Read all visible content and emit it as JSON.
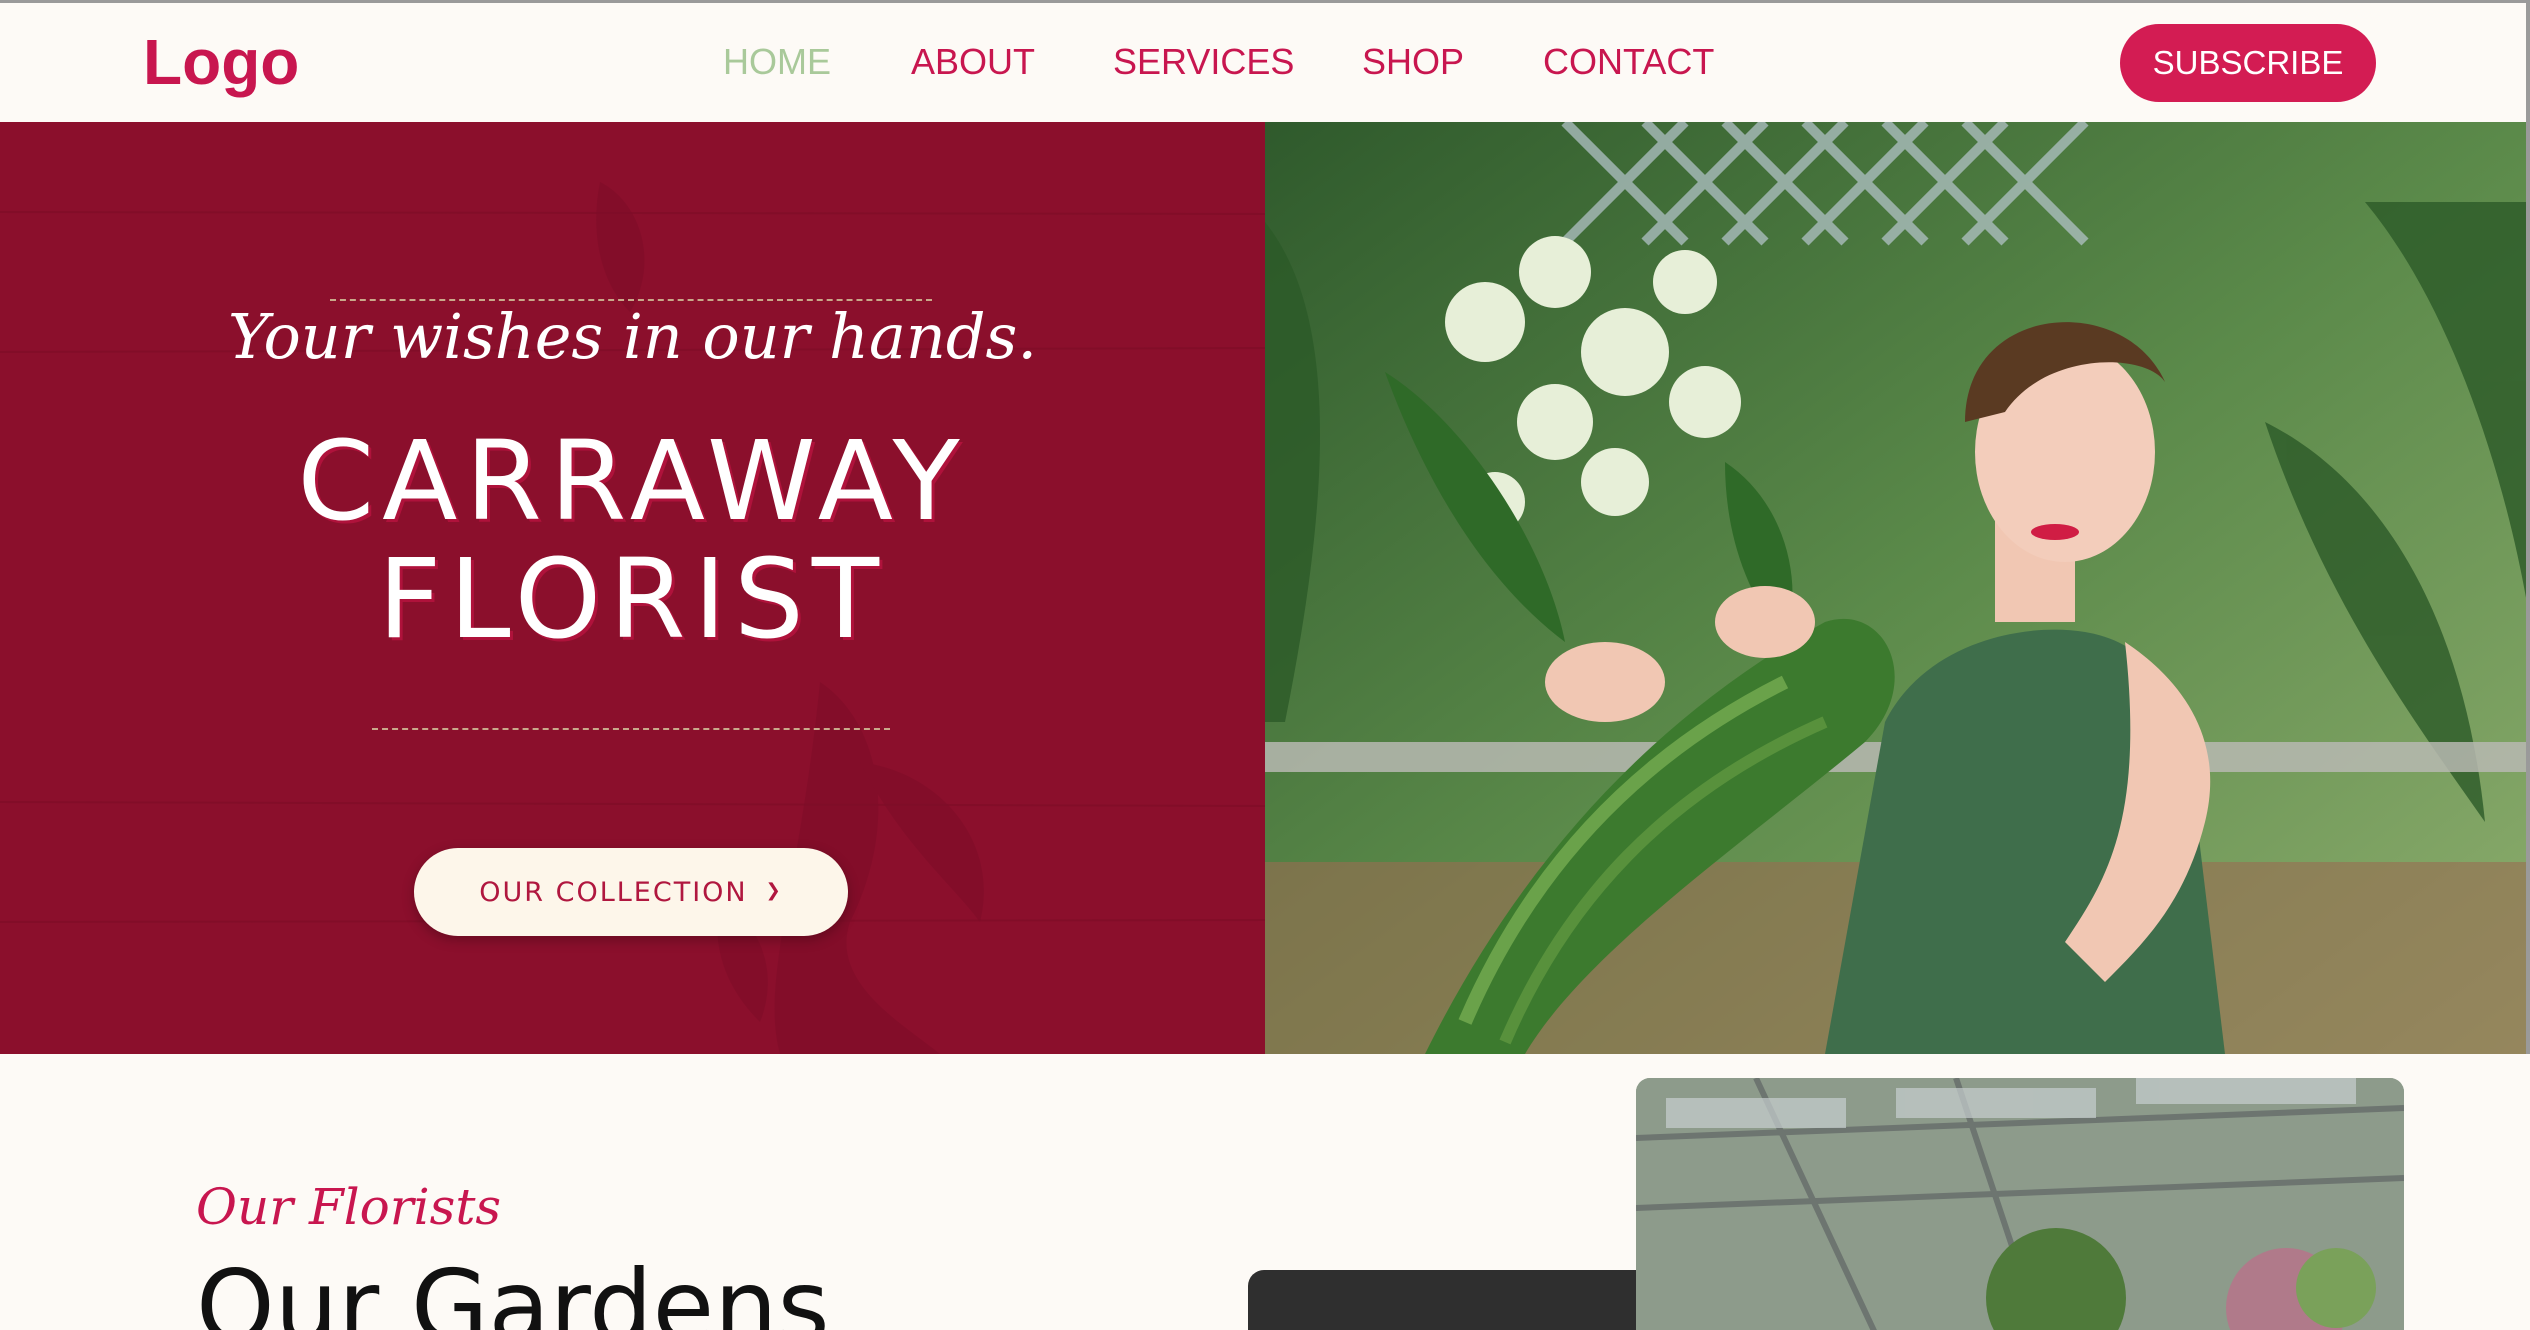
{
  "header": {
    "logo": "Logo",
    "nav": [
      {
        "label": "HOME",
        "active": true
      },
      {
        "label": "ABOUT",
        "active": false
      },
      {
        "label": "SERVICES",
        "active": false
      },
      {
        "label": "SHOP",
        "active": false
      },
      {
        "label": "CONTACT",
        "active": false
      }
    ],
    "subscribe_label": "SUBSCRIBE"
  },
  "hero": {
    "tagline": "Your wishes in our hands.",
    "title_line1": "CARRAWAY",
    "title_line2": "FLORIST",
    "cta_label": "OUR COLLECTION",
    "cta_icon": "chevron-down-icon",
    "photo": "woman-holding-bouquet"
  },
  "section": {
    "subtitle": "Our Florists",
    "title": "Our Gardens",
    "photo": "greenhouse-garden"
  },
  "colors": {
    "brand": "#c8164f",
    "hero_bg": "#8b0f2c",
    "active_nav": "#a9c99a",
    "page_bg": "#fdfaf6"
  }
}
